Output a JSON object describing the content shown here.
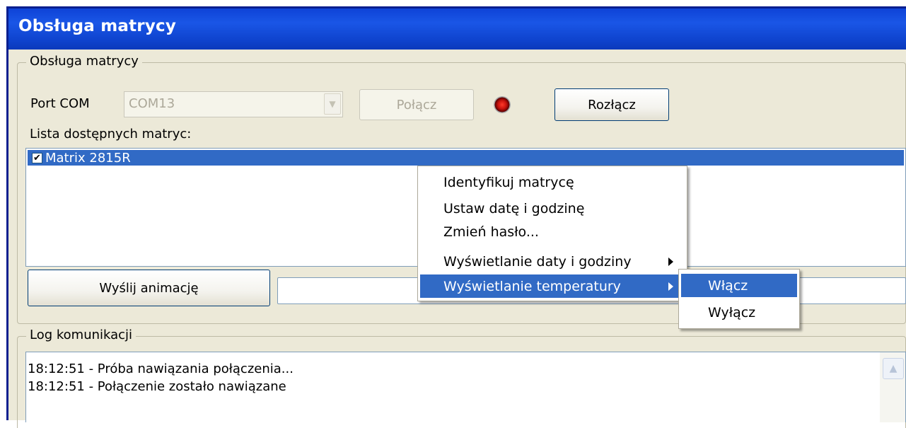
{
  "window": {
    "title": "Obsługa matrycy"
  },
  "main_group": {
    "label": "Obsługa matrycy",
    "port_label": "Port COM",
    "port_value": "COM13",
    "connect_button": "Połącz",
    "disconnect_button": "Rozłącz",
    "connection_status_color": "#c8120c",
    "list_label": "Lista dostępnych matryc:",
    "matrices": [
      {
        "label": "Matrix 2815R",
        "checked": true,
        "check_glyph": "✔"
      }
    ],
    "send_button": "Wyślij animację",
    "progress": 0
  },
  "context_menu": {
    "items": [
      {
        "label": "Identyfikuj matrycę",
        "submenu": false,
        "selected": false
      },
      {
        "label": "Ustaw datę i godzinę",
        "submenu": false,
        "selected": false
      },
      {
        "label": "Zmień hasło...",
        "submenu": false,
        "selected": false
      },
      {
        "label": "Wyświetlanie daty i godziny",
        "submenu": true,
        "selected": false
      },
      {
        "label": "Wyświetlanie temperatury",
        "submenu": true,
        "selected": true
      }
    ],
    "submenu_items": [
      {
        "label": "Włącz",
        "selected": true
      },
      {
        "label": "Wyłącz",
        "selected": false
      }
    ]
  },
  "log_group": {
    "label": "Log komunikacji",
    "lines": [
      "18:12:51 - Próba nawiązania połączenia...",
      "18:12:51 - Połączenie zostało nawiązane"
    ]
  },
  "colors": {
    "titlebar": "#0e43d7",
    "window_bg": "#ece9d8",
    "selection": "#316ac5"
  },
  "icons": {
    "combo_arrow": "chevron-down-icon",
    "scroll_up": "chevron-up-icon",
    "submenu": "chevron-right-icon"
  }
}
